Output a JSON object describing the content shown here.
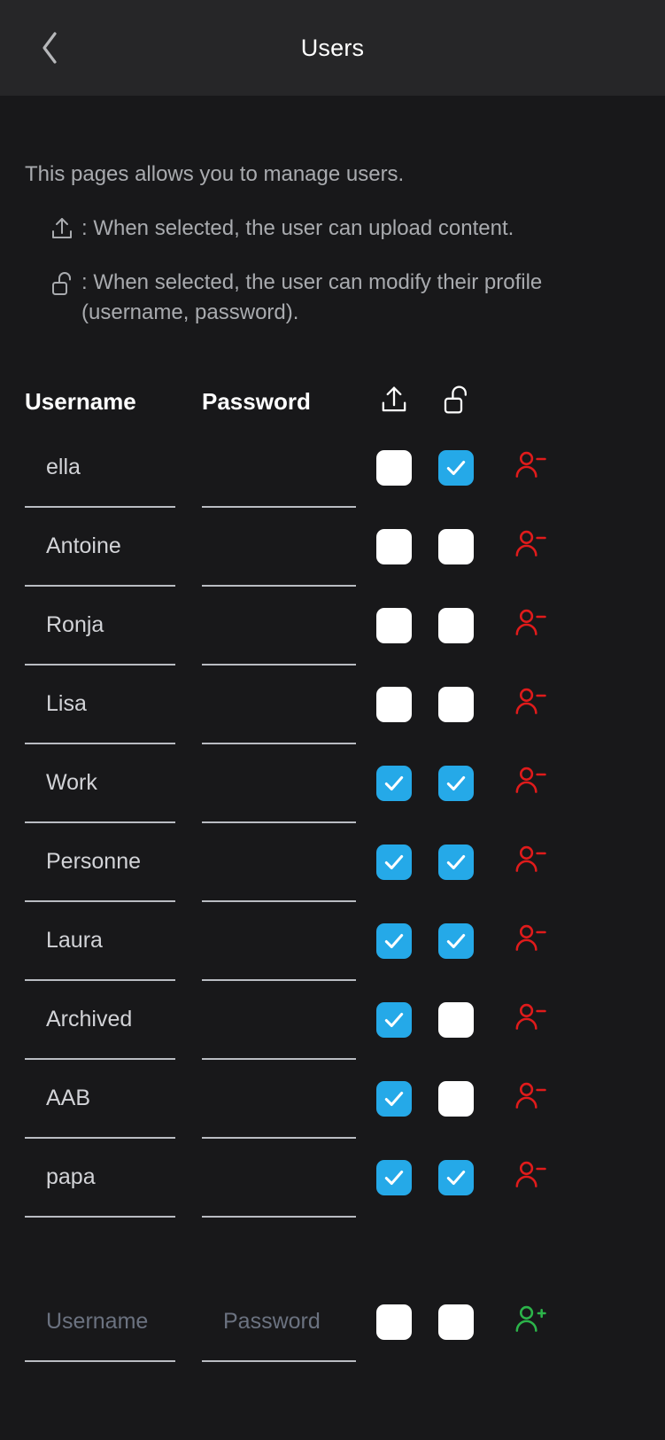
{
  "header": {
    "back_icon": "chevron-left-icon",
    "title": "Users"
  },
  "description": {
    "intro": "This pages allows you to manage users.",
    "legend": [
      {
        "icon": "upload-icon",
        "text": ": When selected, the user can upload content."
      },
      {
        "icon": "unlock-icon",
        "text": ": When selected, the user can modify their profile (username, password)."
      }
    ]
  },
  "table": {
    "columns": {
      "username": "Username",
      "password": "Password",
      "upload_icon": "upload-icon",
      "unlock_icon": "unlock-icon"
    },
    "rows": [
      {
        "username": "ella",
        "password": "",
        "upload": false,
        "unlock": true,
        "action_icon": "person-minus-icon"
      },
      {
        "username": "Antoine",
        "password": "",
        "upload": false,
        "unlock": false,
        "action_icon": "person-minus-icon"
      },
      {
        "username": "Ronja",
        "password": "",
        "upload": false,
        "unlock": false,
        "action_icon": "person-minus-icon"
      },
      {
        "username": "Lisa",
        "password": "",
        "upload": false,
        "unlock": false,
        "action_icon": "person-minus-icon"
      },
      {
        "username": "Work",
        "password": "",
        "upload": true,
        "unlock": true,
        "action_icon": "person-minus-icon"
      },
      {
        "username": "Personne",
        "password": "",
        "upload": true,
        "unlock": true,
        "action_icon": "person-minus-icon"
      },
      {
        "username": "Laura",
        "password": "",
        "upload": true,
        "unlock": true,
        "action_icon": "person-minus-icon"
      },
      {
        "username": "Archived",
        "password": "",
        "upload": true,
        "unlock": false,
        "action_icon": "person-minus-icon"
      },
      {
        "username": "AAB",
        "password": "",
        "upload": true,
        "unlock": false,
        "action_icon": "person-minus-icon"
      },
      {
        "username": "papa",
        "password": "",
        "upload": true,
        "unlock": true,
        "action_icon": "person-minus-icon"
      }
    ],
    "new_row": {
      "username_value": "",
      "username_placeholder": "Username",
      "password_value": "",
      "password_placeholder": "Password",
      "upload": false,
      "unlock": false,
      "action_icon": "person-plus-icon"
    }
  },
  "colors": {
    "appbar_bg": "#262628",
    "page_bg": "#18181a",
    "checkbox_on": "#25a9e8",
    "checkbox_off": "#ffffff",
    "remove_user": "#e01b1b",
    "add_user": "#2cb44a",
    "underline": "#b9bcc2",
    "muted_text": "#a9abaf",
    "placeholder_text": "#6b7280"
  }
}
